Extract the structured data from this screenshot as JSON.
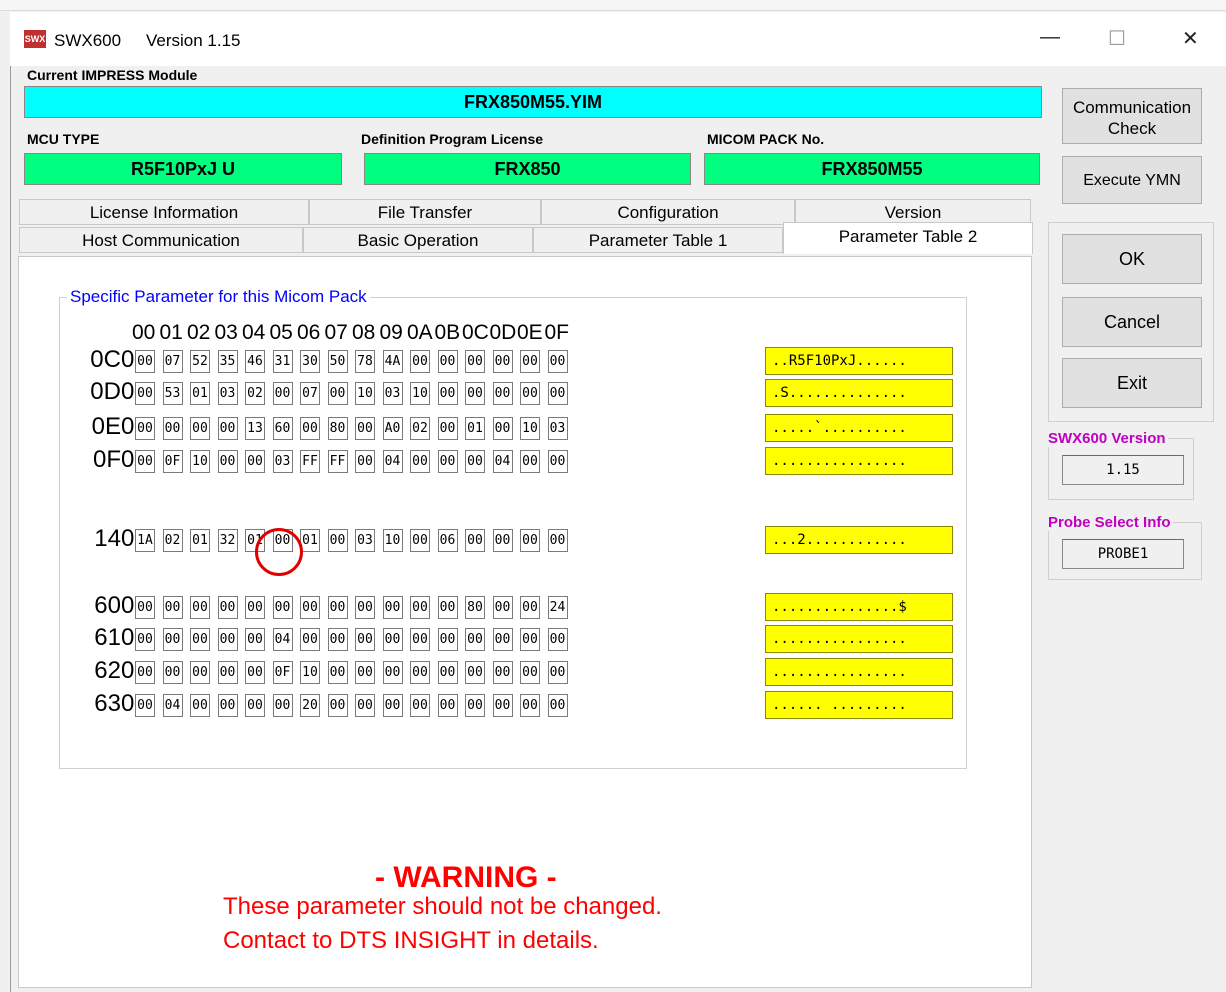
{
  "window": {
    "app_icon_text": "SWX",
    "title_app": "SWX600",
    "title_version": "Version 1.15",
    "minimize_glyph": "—",
    "maximize_glyph": "☐",
    "close_glyph": "✕"
  },
  "module": {
    "label": "Current IMPRESS Module",
    "value": "FRX850M55.YIM"
  },
  "info": {
    "mcu_label": "MCU TYPE",
    "mcu_value": "R5F10PxJ U",
    "license_label": "Definition Program License",
    "license_value": "FRX850",
    "pack_label": "MICOM PACK No.",
    "pack_value": "FRX850M55"
  },
  "tabs": {
    "row1": [
      "License Information",
      "File Transfer",
      "Configuration",
      "Version"
    ],
    "row2": [
      "Host Communication",
      "Basic Operation",
      "Parameter Table 1",
      "Parameter Table 2"
    ],
    "active": "Parameter Table 2"
  },
  "group_title": "Specific Parameter for this Micom Pack",
  "column_headers": [
    "00",
    "01",
    "02",
    "03",
    "04",
    "05",
    "06",
    "07",
    "08",
    "09",
    "0A",
    "0B",
    "0C",
    "0D",
    "0E",
    "0F"
  ],
  "rows": [
    {
      "label": "0C0:",
      "cells": [
        "00",
        "07",
        "52",
        "35",
        "46",
        "31",
        "30",
        "50",
        "78",
        "4A",
        "00",
        "00",
        "00",
        "00",
        "00",
        "00"
      ],
      "ascii": "..R5F10PxJ......"
    },
    {
      "label": "0D0:",
      "cells": [
        "00",
        "53",
        "01",
        "03",
        "02",
        "00",
        "07",
        "00",
        "10",
        "03",
        "10",
        "00",
        "00",
        "00",
        "00",
        "00"
      ],
      "ascii": ".S.............."
    },
    {
      "label": "0E0:",
      "cells": [
        "00",
        "00",
        "00",
        "00",
        "13",
        "60",
        "00",
        "80",
        "00",
        "A0",
        "02",
        "00",
        "01",
        "00",
        "10",
        "03"
      ],
      "ascii": ".....`.........."
    },
    {
      "label": "0F0:",
      "cells": [
        "00",
        "0F",
        "10",
        "00",
        "00",
        "03",
        "FF",
        "FF",
        "00",
        "04",
        "00",
        "00",
        "00",
        "04",
        "00",
        "00"
      ],
      "ascii": "................"
    },
    {
      "label": "140:",
      "cells": [
        "1A",
        "02",
        "01",
        "32",
        "01",
        "00",
        "01",
        "00",
        "03",
        "10",
        "00",
        "06",
        "00",
        "00",
        "00",
        "00"
      ],
      "ascii": "...2............"
    },
    {
      "label": "600:",
      "cells": [
        "00",
        "00",
        "00",
        "00",
        "00",
        "00",
        "00",
        "00",
        "00",
        "00",
        "00",
        "00",
        "80",
        "00",
        "00",
        "24"
      ],
      "ascii": "...............$"
    },
    {
      "label": "610:",
      "cells": [
        "00",
        "00",
        "00",
        "00",
        "00",
        "04",
        "00",
        "00",
        "00",
        "00",
        "00",
        "00",
        "00",
        "00",
        "00",
        "00"
      ],
      "ascii": "................"
    },
    {
      "label": "620:",
      "cells": [
        "00",
        "00",
        "00",
        "00",
        "00",
        "0F",
        "10",
        "00",
        "00",
        "00",
        "00",
        "00",
        "00",
        "00",
        "00",
        "00"
      ],
      "ascii": "................"
    },
    {
      "label": "630:",
      "cells": [
        "00",
        "04",
        "00",
        "00",
        "00",
        "00",
        "20",
        "00",
        "00",
        "00",
        "00",
        "00",
        "00",
        "00",
        "00",
        "00"
      ],
      "ascii": "...... ........."
    }
  ],
  "warning": {
    "title": "- WARNING -",
    "line1": "These parameter should not be changed.",
    "line2": "Contact to DTS INSIGHT in details."
  },
  "buttons": {
    "comm_check_line1": "Communication",
    "comm_check_line2": "Check",
    "execute_ymn": "Execute YMN",
    "ok": "OK",
    "cancel": "Cancel",
    "exit": "Exit"
  },
  "version_box": {
    "label": "SWX600 Version",
    "value": "1.15"
  },
  "probe_box": {
    "label": "Probe Select Info",
    "value": "PROBE1"
  },
  "colors": {
    "module_bar": "#00ffff",
    "info_bar": "#00ff80",
    "ascii_bg": "#ffff00",
    "group_title": "#0000ff",
    "side_label": "#c000c0",
    "warning": "#ff0000",
    "highlight_circle": "#e00000"
  }
}
